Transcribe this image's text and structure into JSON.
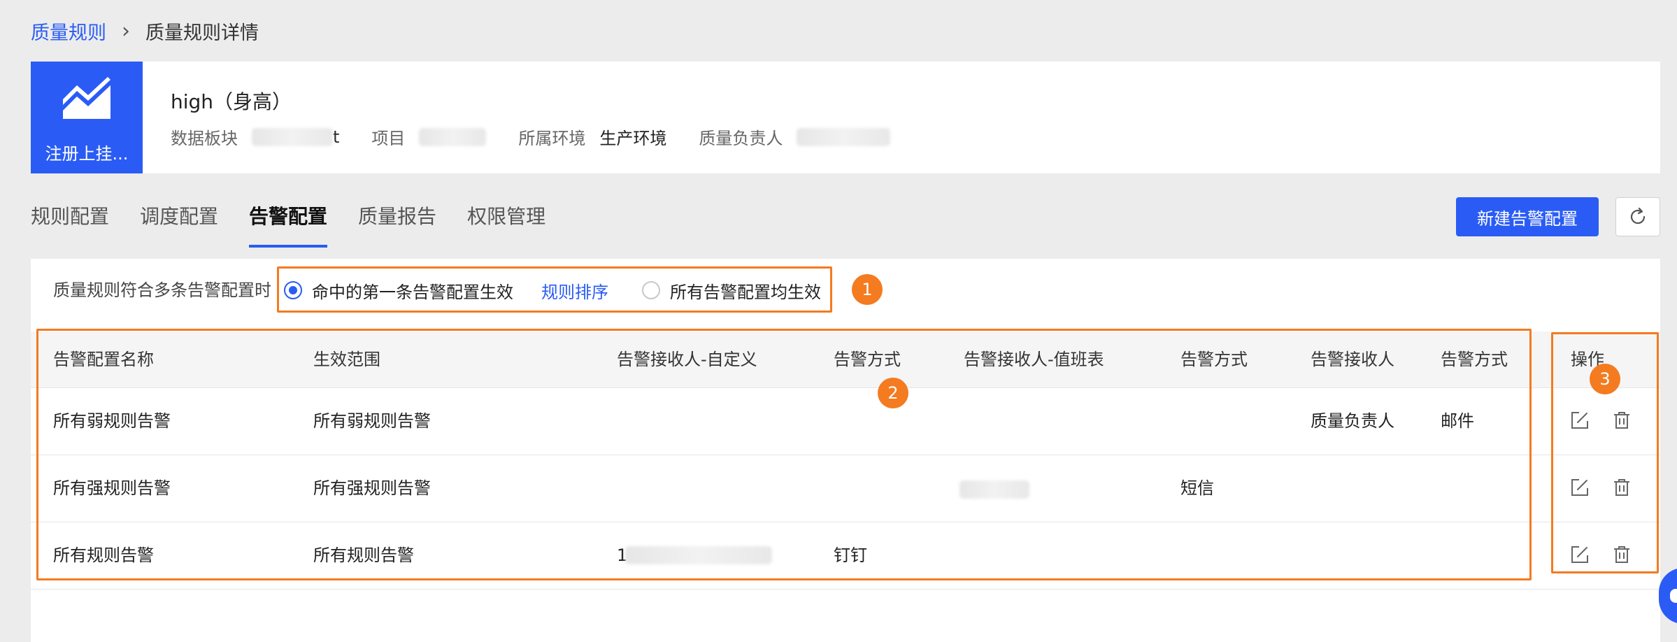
{
  "breadcrumb": {
    "parent": "质量规则",
    "separator": "›",
    "current": "质量规则详情"
  },
  "header": {
    "logo_label": "注册上挂...",
    "title": "high（身高）",
    "meta": [
      {
        "label": "数据板块",
        "value": "t",
        "blurred": true
      },
      {
        "label": "项目",
        "value": "",
        "blurred": true
      },
      {
        "label": "所属环境",
        "value": "生产环境",
        "blurred": false
      },
      {
        "label": "质量负责人",
        "value": "",
        "blurred": true
      }
    ]
  },
  "tabs": [
    {
      "label": "规则配置",
      "active": false
    },
    {
      "label": "调度配置",
      "active": false
    },
    {
      "label": "告警配置",
      "active": true
    },
    {
      "label": "质量报告",
      "active": false
    },
    {
      "label": "权限管理",
      "active": false
    }
  ],
  "toolbar": {
    "new_button": "新建告警配置",
    "refresh_icon": "refresh-icon"
  },
  "config": {
    "label": "质量规则符合多条告警配置时",
    "option1": "命中的第一条告警配置生效",
    "option1_selected": true,
    "sort_link": "规则排序",
    "option2": "所有告警配置均生效",
    "option2_selected": false
  },
  "annotations": {
    "badge1": "1",
    "badge2": "2",
    "badge3": "3"
  },
  "table": {
    "columns": [
      "告警配置名称",
      "生效范围",
      "告警接收人-自定义",
      "告警方式",
      "告警接收人-值班表",
      "告警方式",
      "告警接收人",
      "告警方式",
      "操作"
    ],
    "rows": [
      {
        "cells": [
          "所有弱规则告警",
          "所有弱规则告警",
          "",
          "",
          "",
          "",
          "质量负责人",
          "邮件"
        ],
        "blurred": []
      },
      {
        "cells": [
          "所有强规则告警",
          "所有强规则告警",
          "",
          "",
          "",
          "短信",
          "",
          ""
        ],
        "blurred": [
          4
        ]
      },
      {
        "cells": [
          "所有规则告警",
          "所有规则告警",
          "1",
          "钉钉",
          "",
          "",
          "",
          ""
        ],
        "blurred": [
          2
        ]
      }
    ],
    "action_icons": [
      "edit-icon",
      "delete-icon"
    ]
  },
  "colors": {
    "primary": "#2a5cf5",
    "annotation": "#f47b20",
    "page_bg": "#ececec"
  }
}
